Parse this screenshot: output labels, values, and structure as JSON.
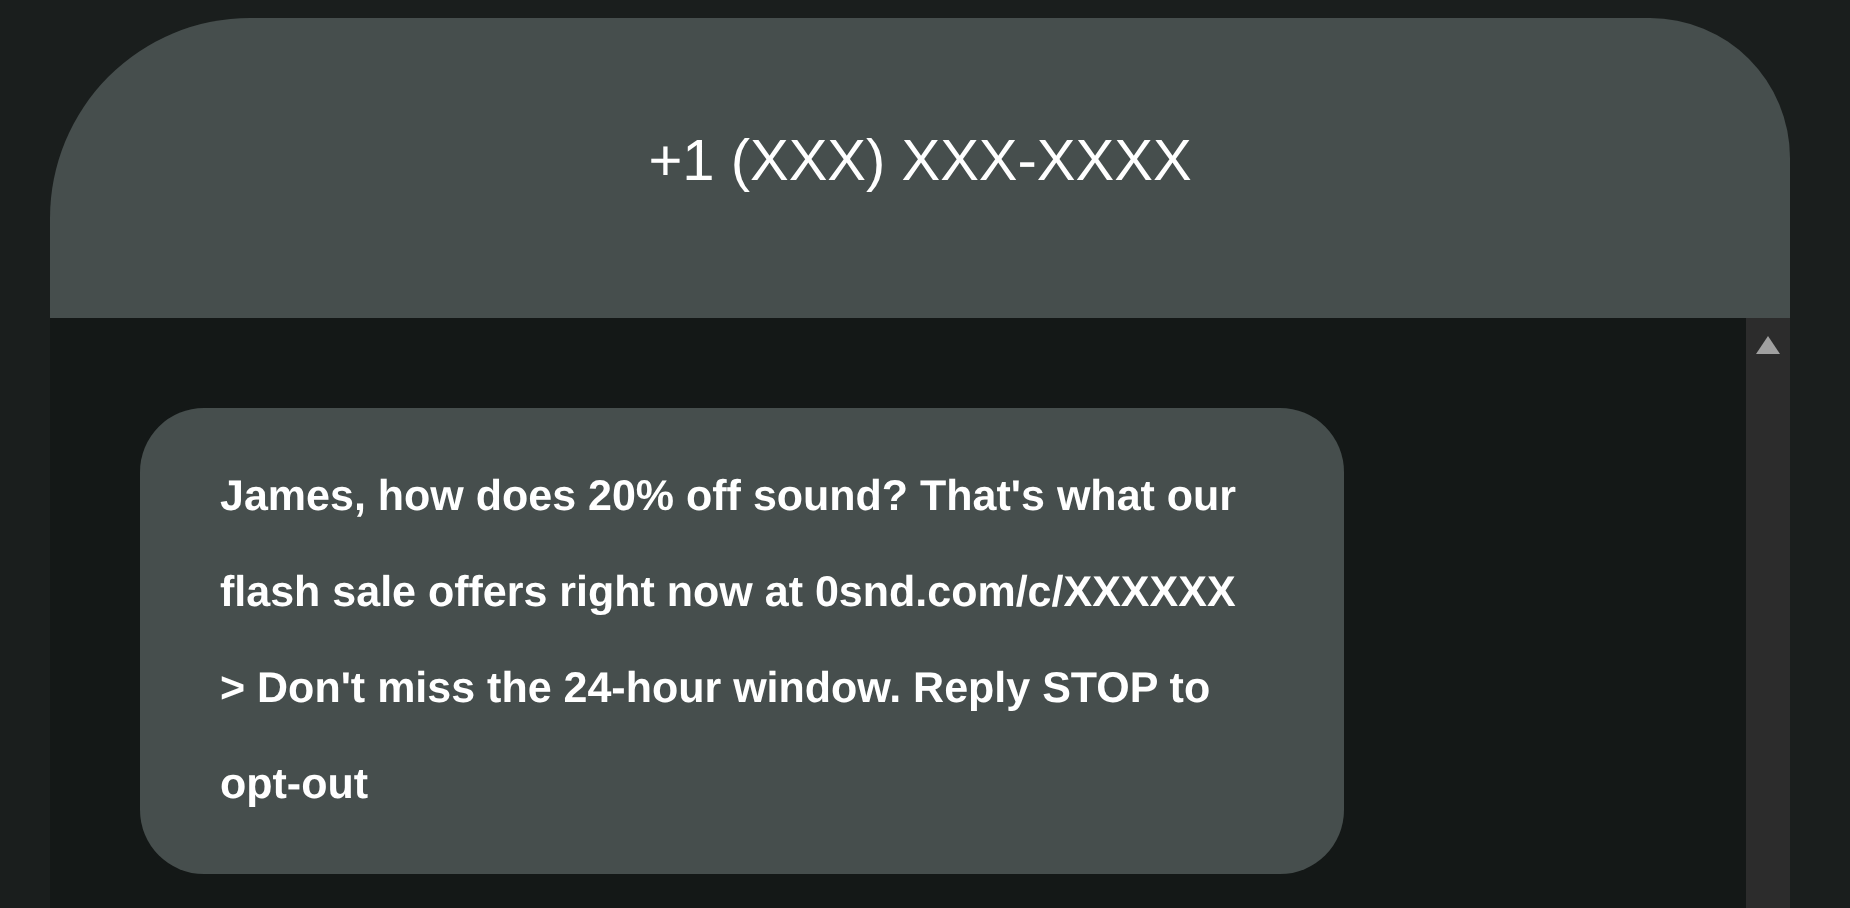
{
  "header": {
    "title": "+1 (XXX) XXX-XXXX"
  },
  "messages": [
    {
      "text": "James, how does 20% off sound? That's what our flash sale offers right now at 0snd.com/c/XXXXXX > Don't miss the 24-hour window. Reply STOP to opt-out",
      "kind": "incoming"
    }
  ]
}
